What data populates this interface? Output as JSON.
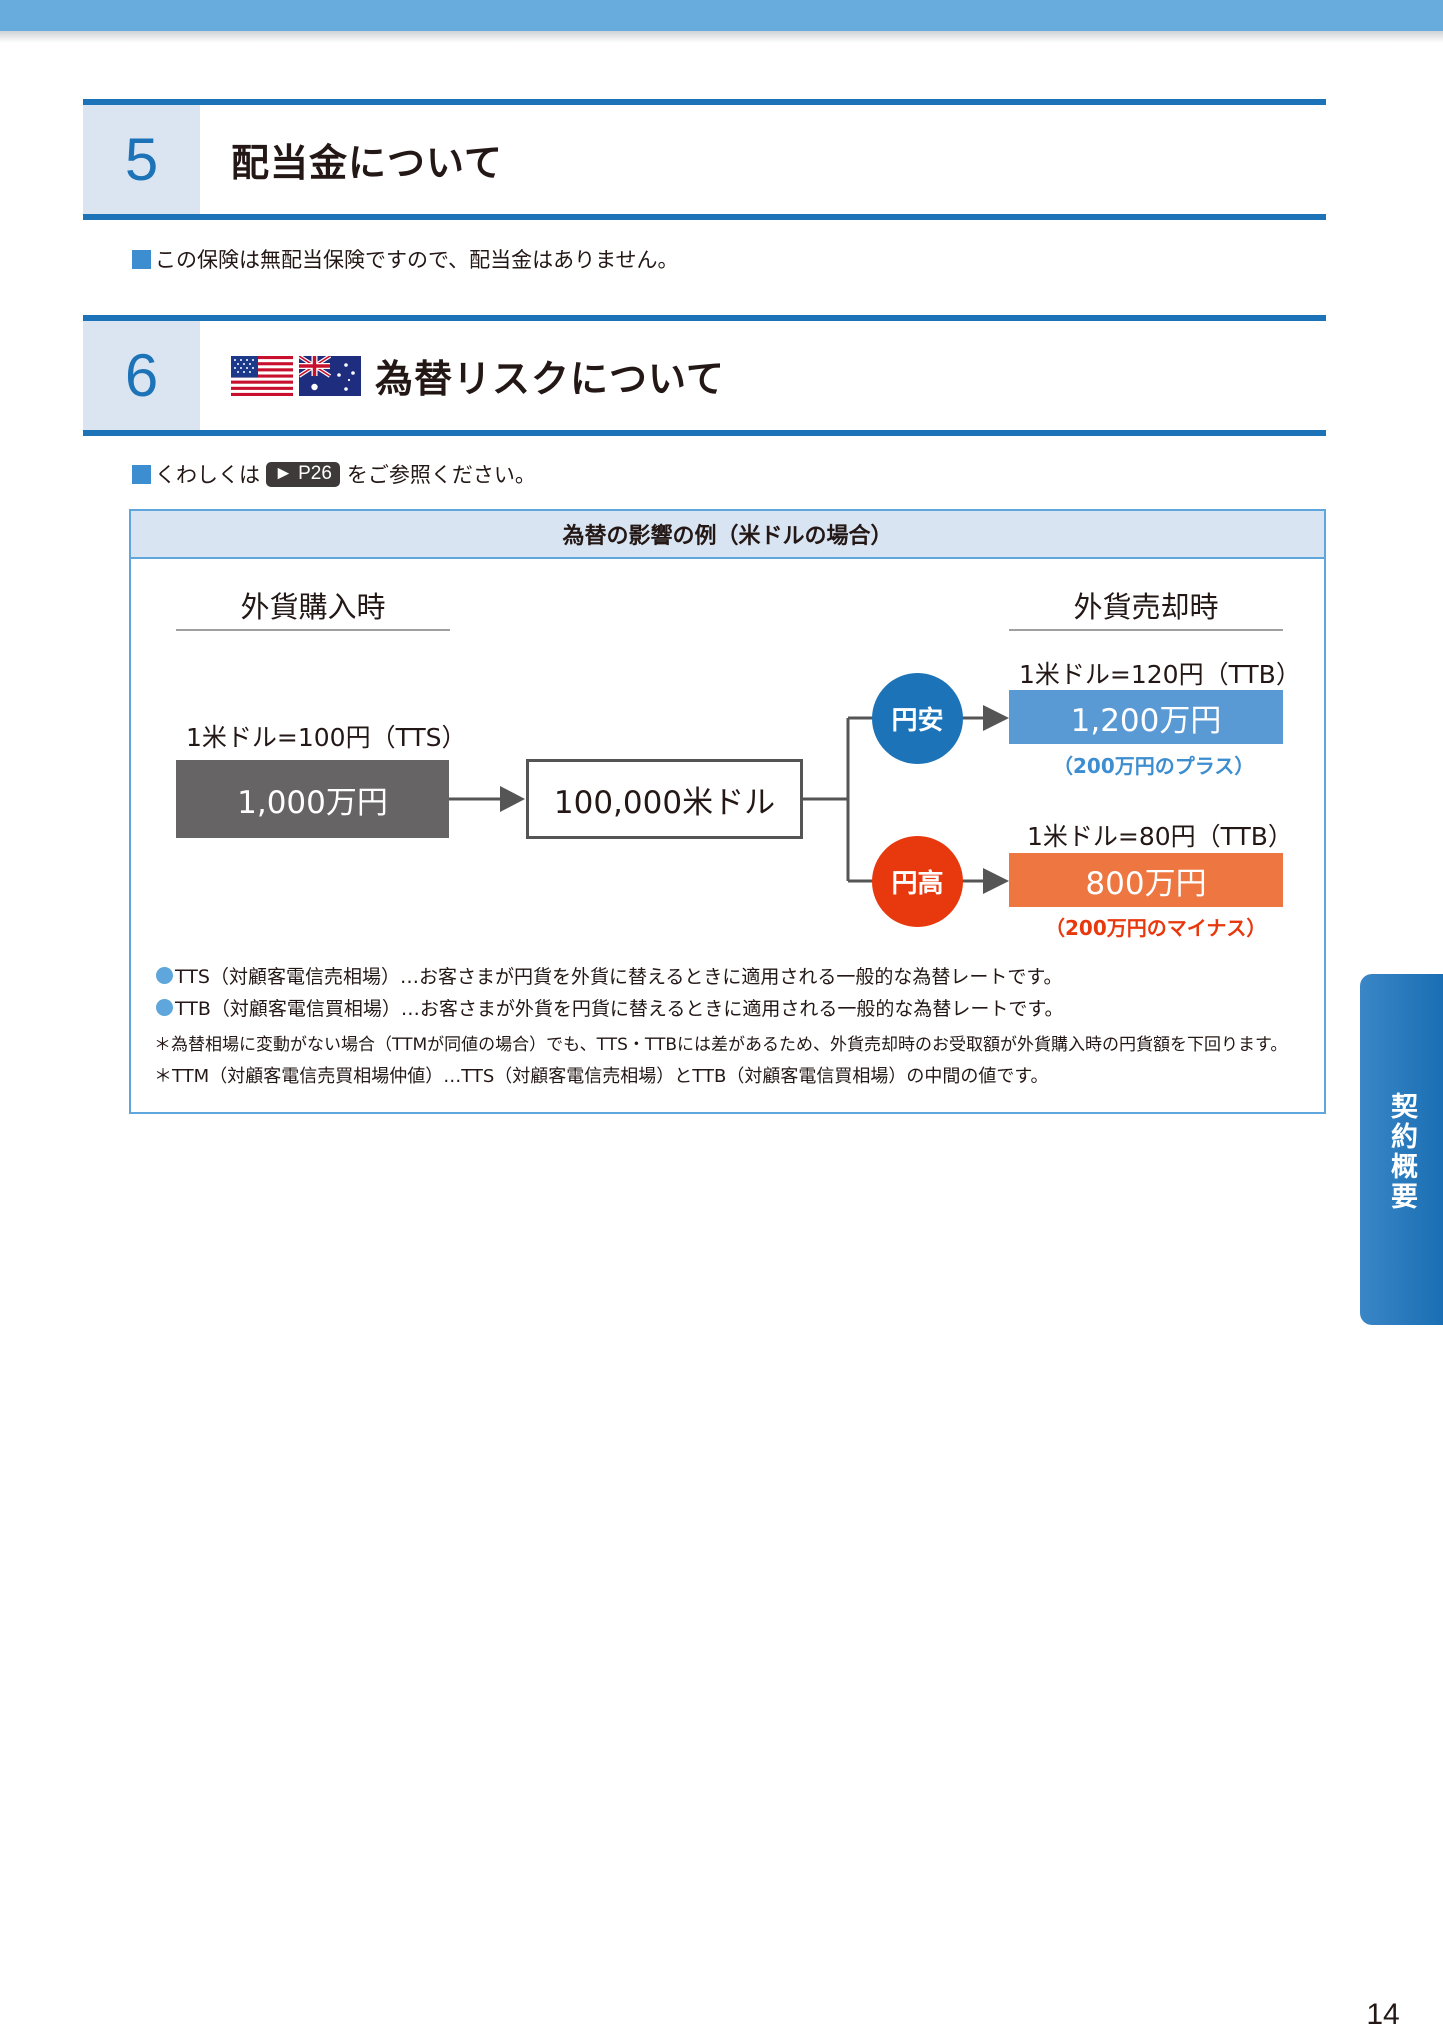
{
  "section5": {
    "number": "5",
    "title": "配当金について",
    "body": "この保険は無配当保険ですので、配当金はありません。"
  },
  "section6": {
    "number": "6",
    "title": "為替リスクについて",
    "ref_before": "くわしくは",
    "ref_page": "► P26",
    "ref_after": "をご参照ください。"
  },
  "example": {
    "title": "為替の影響の例（米ドルの場合）",
    "purchase_title": "外貨購入時",
    "sale_title": "外貨売却時",
    "purchase_rate": "1米ドル=100円（TTS）",
    "purchase_amount": "1,000万円",
    "usd_amount": "100,000米ドル",
    "weak_yen": {
      "label": "円安",
      "rate": "1米ドル=120円（TTB）",
      "amount": "1,200万円",
      "note": "（200万円のプラス）"
    },
    "strong_yen": {
      "label": "円高",
      "rate": "1米ドル=80円（TTB）",
      "amount": "800万円",
      "note": "（200万円のマイナス）"
    },
    "notes": [
      "TTS（対顧客電信売相場）…お客さまが円貨を外貨に替えるときに適用される一般的な為替レートです。",
      "TTB（対顧客電信買相場）…お客さまが外貨を円貨に替えるときに適用される一般的な為替レートです。"
    ],
    "footnotes": [
      "＊為替相場に変動がない場合（TTMが同値の場合）でも、TTS・TTBには差があるため、外貨売却時のお受取額が外貨購入時の円貨額を下回ります。",
      "＊TTM（対顧客電信売買相場仲値）…TTS（対顧客電信売相場）とTTB（対顧客電信買相場）の中間の値です。"
    ]
  },
  "side_tab": "契約概要",
  "page_number": "14",
  "colors": {
    "brand_blue": "#1c73b7",
    "light_blue": "#dbe5f2",
    "weak_yen_blue": "#1c73b7",
    "weak_yen_box": "#5a9ad4",
    "strong_yen_red": "#e8380d",
    "strong_yen_box": "#ee7640",
    "purchase_box": "#666464"
  },
  "icons": [
    "us-flag-icon",
    "australia-flag-icon",
    "arrow-right-icon"
  ]
}
